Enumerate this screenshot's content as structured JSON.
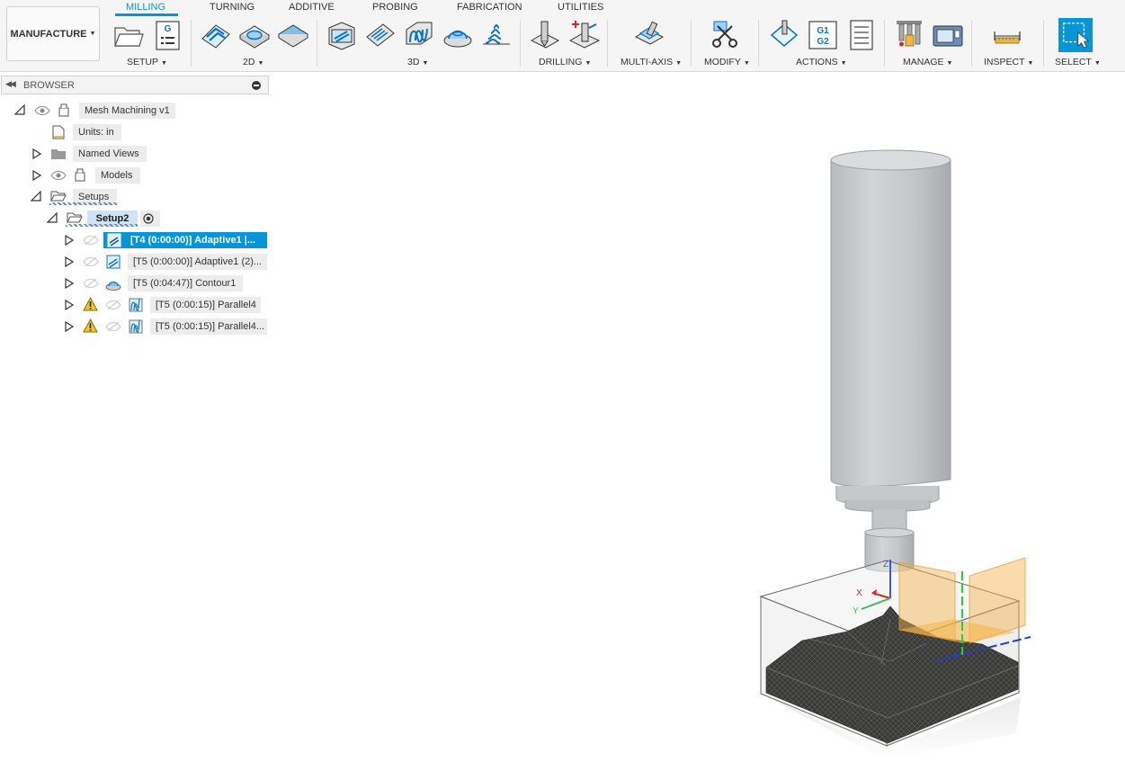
{
  "workspace": {
    "label": "MANUFACTURE"
  },
  "tabs": [
    {
      "label": "MILLING",
      "active": true
    },
    {
      "label": "TURNING"
    },
    {
      "label": "ADDITIVE"
    },
    {
      "label": "PROBING"
    },
    {
      "label": "FABRICATION"
    },
    {
      "label": "UTILITIES"
    }
  ],
  "groups": {
    "setup": "SETUP",
    "g2d": "2D",
    "g3d": "3D",
    "drilling": "DRILLING",
    "multiaxis": "MULTI-AXIS",
    "modify": "MODIFY",
    "actions": "ACTIONS",
    "manage": "MANAGE",
    "inspect": "INSPECT",
    "select": "SELECT"
  },
  "icon_text": {
    "nc_program": "G",
    "post_line1": "G1",
    "post_line2": "G2"
  },
  "browser": {
    "title": "BROWSER",
    "root": "Mesh Machining v1",
    "units": "Units: in",
    "named_views": "Named Views",
    "models": "Models",
    "setups": "Setups",
    "setup": "Setup2",
    "operations": [
      {
        "label": "[T4 (0:00:00)] Adaptive1 |...",
        "selected": true
      },
      {
        "label": "[T5 (0:00:00)] Adaptive1 (2)..."
      },
      {
        "label": "[T5 (0:04:47)] Contour1"
      },
      {
        "label": "[T5 (0:00:15)] Parallel4",
        "warning": true
      },
      {
        "label": "[T5 (0:00:15)] Parallel4...",
        "warning": true
      }
    ]
  },
  "viewport": {
    "axis_labels": {
      "x": "X",
      "y": "Y",
      "z": "Z"
    }
  },
  "colors": {
    "accent": "#0696d7",
    "warning": "#f5c518",
    "setup_highlight": "#cfe3f7"
  }
}
